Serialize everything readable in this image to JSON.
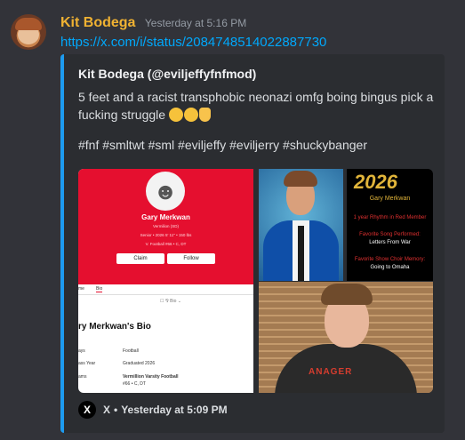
{
  "message": {
    "username": "Kit Bodega",
    "timestamp": "Yesterday at 5:16 PM",
    "link_text": "https://x.com/i/status/2084748514022887730"
  },
  "embed": {
    "author": "Kit Bodega (@eviljeffyfnfmod)",
    "description_line1": "5 feet and a racist transphobic neonazi omfg boing bingus pick a",
    "description_line2": "fucking struggle",
    "emojis": [
      "loudly-crying-face",
      "loudly-crying-face",
      "victory-hand"
    ],
    "hashtags": "#fnf #smltwt #sml #eviljeffy #eviljerry #shuckybanger",
    "footer_source": "X",
    "footer_sep": "•",
    "footer_time": "Yesterday at 5:09 PM",
    "accent_color": "#1d9bf0"
  },
  "images": {
    "profile_card": {
      "name": "Gary Merkwan",
      "sub1": "Vermilion (SD)",
      "sub2": "Senior • 2026   5' 11\" • 150 lbs",
      "sub3": "V. Football #66 • C, DT",
      "claim_label": "Claim",
      "follow_label": "Follow",
      "tab_home": "me",
      "tab_bio": "Bio",
      "filter": "☐ ⅋ Bio ⌄",
      "bio_title": "ry Merkwan's Bio",
      "rows": [
        {
          "label": "ays",
          "value": "Football"
        },
        {
          "label": "ass Year",
          "value": "Graduated 2026"
        },
        {
          "label": "ams",
          "value": "Vermillion Varsity Football",
          "value2": "#66 • C, DT"
        }
      ]
    },
    "graphic": {
      "year": "2026",
      "name": "Gary Merkwan",
      "l1": "1 year Rhythm in Red Member",
      "l2": "Favorite Song Performed:",
      "l3": "Letters From War",
      "l4": "Favorite Show Choir Memory:",
      "l5": "Going to Omaha"
    },
    "tshirt_text": "ANAGER"
  }
}
